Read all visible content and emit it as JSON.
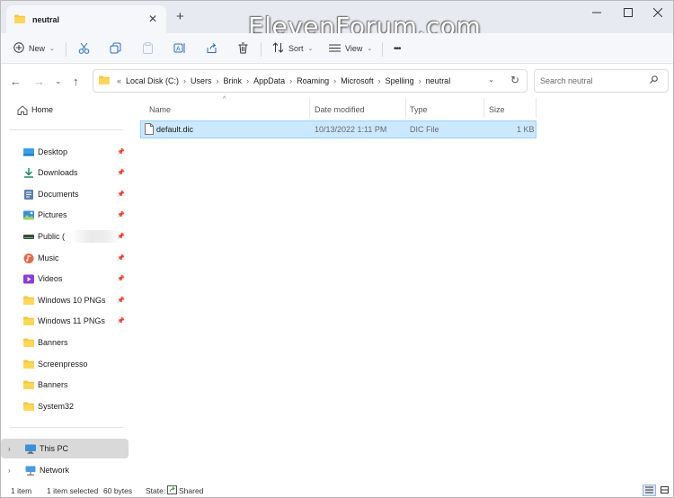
{
  "watermark": "ElevenForum.com",
  "tab": {
    "title": "neutral"
  },
  "toolbar": {
    "new_label": "New",
    "sort_label": "Sort",
    "view_label": "View",
    "more_label": "•••"
  },
  "address": {
    "overflow": "«",
    "crumbs": [
      "Local Disk (C:)",
      "Users",
      "Brink",
      "AppData",
      "Roaming",
      "Microsoft",
      "Spelling",
      "neutral"
    ]
  },
  "search": {
    "placeholder": "Search neutral"
  },
  "sidebar": {
    "home": "Home",
    "quick_access": [
      {
        "label": "Desktop",
        "icon": "desktop-icon"
      },
      {
        "label": "Downloads",
        "icon": "downloads-icon"
      },
      {
        "label": "Documents",
        "icon": "documents-icon"
      },
      {
        "label": "Pictures",
        "icon": "pictures-icon"
      },
      {
        "label": "Public (",
        "icon": "drive-icon"
      },
      {
        "label": "Music",
        "icon": "music-icon"
      },
      {
        "label": "Videos",
        "icon": "videos-icon"
      },
      {
        "label": "Windows 10 PNGs",
        "icon": "folder-icon"
      },
      {
        "label": "Windows 11 PNGs",
        "icon": "folder-icon"
      },
      {
        "label": "Banners",
        "icon": "folder-icon"
      },
      {
        "label": "Screenpresso",
        "icon": "folder-icon"
      },
      {
        "label": "Banners",
        "icon": "folder-icon"
      },
      {
        "label": "System32",
        "icon": "folder-icon"
      }
    ],
    "this_pc": "This PC",
    "network": "Network"
  },
  "columns": {
    "name": "Name",
    "date": "Date modified",
    "type": "Type",
    "size": "Size"
  },
  "files": [
    {
      "name": "default.dic",
      "date": "10/13/2022 1:11 PM",
      "type": "DIC File",
      "size": "1 KB"
    }
  ],
  "status": {
    "item_count": "1 item",
    "selected": "1 item selected",
    "bytes": "60 bytes",
    "state_label": "State:",
    "state_value": "Shared"
  },
  "colors": {
    "selection": "#cce8ff",
    "selection_border": "#99d1ff",
    "folder": "#f4c542",
    "accent": "#0067c0"
  }
}
